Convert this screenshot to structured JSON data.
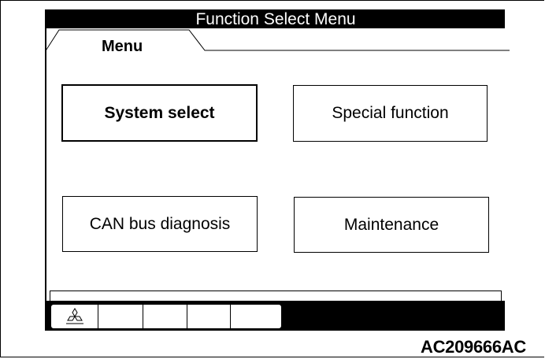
{
  "window": {
    "title": "Function Select Menu"
  },
  "tab": {
    "label": "Menu"
  },
  "menu": {
    "buttons": [
      {
        "label": "System select",
        "selected": true
      },
      {
        "label": "Special function",
        "selected": false
      },
      {
        "label": "CAN bus diagnosis",
        "selected": false
      },
      {
        "label": "Maintenance",
        "selected": false
      }
    ]
  },
  "toolbar": {
    "first_icon": "mitsubishi-logo-icon",
    "empty_slots": 4
  },
  "figure": {
    "code": "AC209666AC"
  }
}
